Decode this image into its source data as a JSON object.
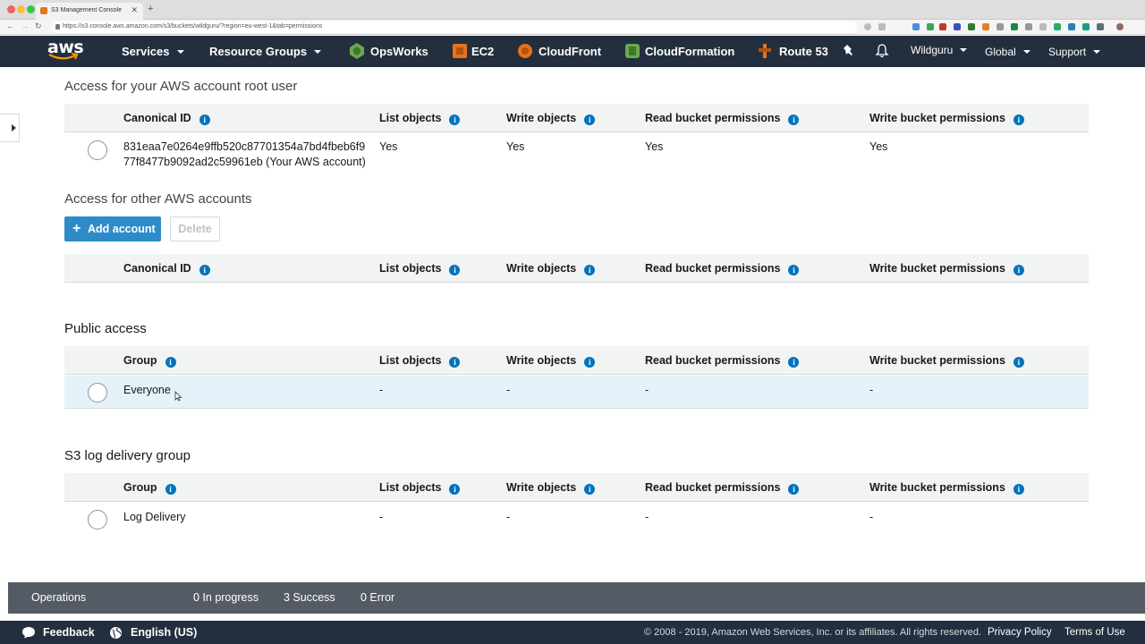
{
  "browser": {
    "tab_title": "S3 Management Console",
    "url": "https://s3.console.aws.amazon.com/s3/buckets/wildguru/?region=eu-west-1&tab=permissions",
    "traffic_colors": [
      "#fc605c",
      "#fdbc40",
      "#34c84a"
    ]
  },
  "nav": {
    "logo": "aws",
    "services": "Services",
    "resource_groups": "Resource Groups",
    "shortcuts": [
      {
        "label": "OpsWorks",
        "icon": "opsworks-icon",
        "color": "#6aa84f"
      },
      {
        "label": "EC2",
        "icon": "ec2-icon",
        "color": "#e8711c"
      },
      {
        "label": "CloudFront",
        "icon": "cloudfront-icon",
        "color": "#e8711c"
      },
      {
        "label": "CloudFormation",
        "icon": "cloudformation-icon",
        "color": "#6aa84f"
      },
      {
        "label": "Route 53",
        "icon": "route53-icon",
        "color": "#e8711c"
      }
    ],
    "user": "Wildguru",
    "region": "Global",
    "support": "Support"
  },
  "root_section": {
    "title": "Access for your AWS account root user",
    "headers": [
      "Canonical ID",
      "List objects",
      "Write objects",
      "Read bucket permissions",
      "Write bucket permissions"
    ],
    "row": {
      "id_line1": "831eaa7e0264e9ffb520c87701354a7bd4fbeb6f9",
      "id_line2": "77f8477b9092ad2c59961eb (Your AWS account)",
      "list": "Yes",
      "write": "Yes",
      "read_perm": "Yes",
      "write_perm": "Yes"
    }
  },
  "other_section": {
    "title": "Access for other AWS accounts",
    "add_button": "Add account",
    "delete_button": "Delete",
    "headers": [
      "Canonical ID",
      "List objects",
      "Write objects",
      "Read bucket permissions",
      "Write bucket permissions"
    ]
  },
  "public_section": {
    "title": "Public access",
    "headers": [
      "Group",
      "List objects",
      "Write objects",
      "Read bucket permissions",
      "Write bucket permissions"
    ],
    "row": {
      "group": "Everyone",
      "list": "-",
      "write": "-",
      "read_perm": "-",
      "write_perm": "-"
    }
  },
  "log_section": {
    "title": "S3 log delivery group",
    "headers": [
      "Group",
      "List objects",
      "Write objects",
      "Read bucket permissions",
      "Write bucket permissions"
    ],
    "row": {
      "group": "Log Delivery",
      "list": "-",
      "write": "-",
      "read_perm": "-",
      "write_perm": "-"
    }
  },
  "operations": {
    "label": "Operations",
    "in_progress": "0 In progress",
    "success": "3 Success",
    "error": "0 Error"
  },
  "footer": {
    "feedback": "Feedback",
    "language": "English (US)",
    "copyright": "© 2008 - 2019, Amazon Web Services, Inc. or its affiliates. All rights reserved.",
    "privacy": "Privacy Policy",
    "terms": "Terms of Use"
  }
}
